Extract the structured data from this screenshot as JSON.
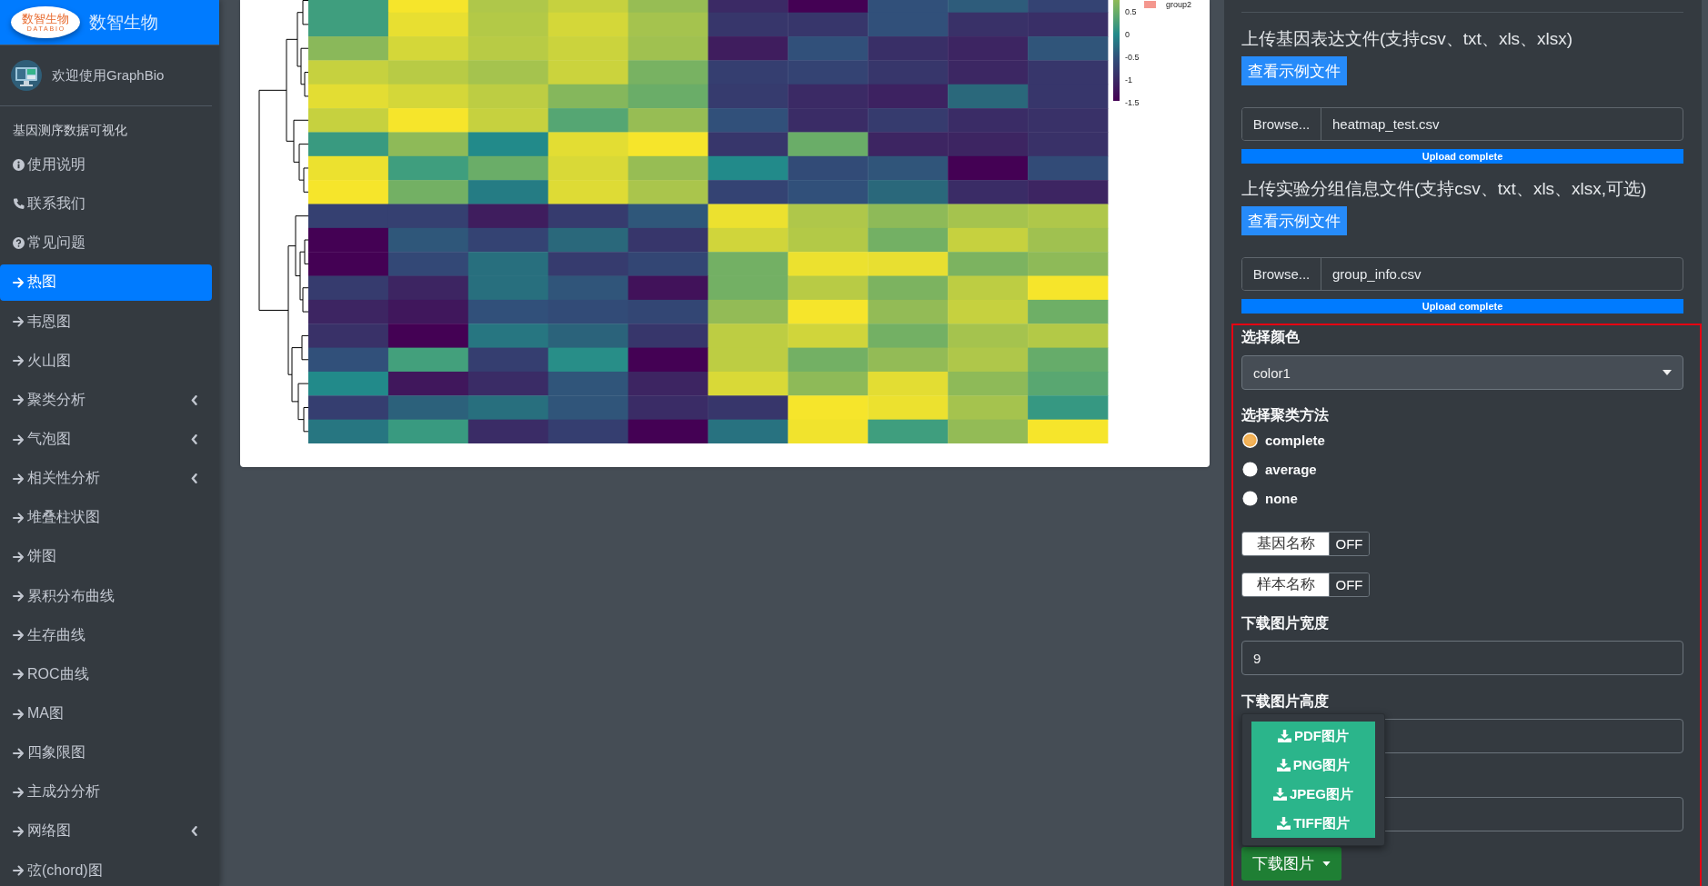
{
  "sidebar": {
    "brand": {
      "logo_text": "数智生物",
      "logo_subtext": "DATABIO",
      "title": "数智生物"
    },
    "user": {
      "greeting": "欢迎使用GraphBio"
    },
    "section_header": "基因测序数据可视化",
    "items": [
      {
        "label": "使用说明",
        "kind": "info",
        "selected": false,
        "expandable": false
      },
      {
        "label": "联系我们",
        "kind": "phone",
        "selected": false,
        "expandable": false
      },
      {
        "label": "常见问题",
        "kind": "help",
        "selected": false,
        "expandable": false
      },
      {
        "label": "热图",
        "kind": "arrow",
        "selected": true,
        "expandable": false
      },
      {
        "label": "韦恩图",
        "kind": "arrow",
        "selected": false,
        "expandable": false
      },
      {
        "label": "火山图",
        "kind": "arrow",
        "selected": false,
        "expandable": false
      },
      {
        "label": "聚类分析",
        "kind": "arrow",
        "selected": false,
        "expandable": true
      },
      {
        "label": "气泡图",
        "kind": "arrow",
        "selected": false,
        "expandable": true
      },
      {
        "label": "相关性分析",
        "kind": "arrow",
        "selected": false,
        "expandable": true
      },
      {
        "label": "堆叠柱状图",
        "kind": "arrow",
        "selected": false,
        "expandable": false
      },
      {
        "label": "饼图",
        "kind": "arrow",
        "selected": false,
        "expandable": false
      },
      {
        "label": "累积分布曲线",
        "kind": "arrow",
        "selected": false,
        "expandable": false
      },
      {
        "label": "生存曲线",
        "kind": "arrow",
        "selected": false,
        "expandable": false
      },
      {
        "label": "ROC曲线",
        "kind": "arrow",
        "selected": false,
        "expandable": false
      },
      {
        "label": "MA图",
        "kind": "arrow",
        "selected": false,
        "expandable": false
      },
      {
        "label": "四象限图",
        "kind": "arrow",
        "selected": false,
        "expandable": false
      },
      {
        "label": "主成分分析",
        "kind": "arrow",
        "selected": false,
        "expandable": false
      },
      {
        "label": "网络图",
        "kind": "arrow",
        "selected": false,
        "expandable": true
      },
      {
        "label": "弦(chord)图",
        "kind": "arrow",
        "selected": false,
        "expandable": false
      }
    ]
  },
  "plot": {
    "color_scale_labels": [
      "0.5",
      "0",
      "-0.5",
      "-1",
      "-1.5"
    ],
    "groups": [
      {
        "label": "group2",
        "color": "#f4978e"
      }
    ]
  },
  "controls": {
    "uploads": [
      {
        "heading": "上传基因表达文件(支持csv、txt、xls、xlsx)",
        "example_button": "查看示例文件",
        "browse_button": "Browse...",
        "file_name": "heatmap_test.csv",
        "progress": {
          "label": "Upload complete",
          "level": 1
        }
      },
      {
        "heading": "上传实验分组信息文件(支持csv、txt、xls、xlsx,可选)",
        "example_button": "查看示例文件",
        "browse_button": "Browse...",
        "file_name": "group_info.csv",
        "progress": {
          "label": "Upload complete",
          "level": 1
        }
      }
    ],
    "options": {
      "highlighted": true,
      "color": {
        "label": "选择颜色",
        "value": "color1"
      },
      "clustering": {
        "label": "选择聚类方法",
        "options": [
          {
            "label": "complete",
            "selected": true
          },
          {
            "label": "average",
            "selected": false
          },
          {
            "label": "none",
            "selected": false
          }
        ]
      },
      "switches": [
        {
          "label": "基因名称",
          "state_label": "OFF",
          "on": false
        },
        {
          "label": "样本名称",
          "state_label": "OFF",
          "on": false
        }
      ],
      "fields": [
        {
          "kind": "text",
          "label": "下载图片宽度",
          "value": "9"
        },
        {
          "kind": "text",
          "label": "下载图片高度"
        },
        {
          "kind": "text"
        }
      ],
      "download": {
        "label": "下载图片",
        "menu_open": true,
        "menu_items": [
          "PDF图片",
          "PNG图片",
          "JPEG图片",
          "TIFF图片"
        ]
      }
    }
  }
}
